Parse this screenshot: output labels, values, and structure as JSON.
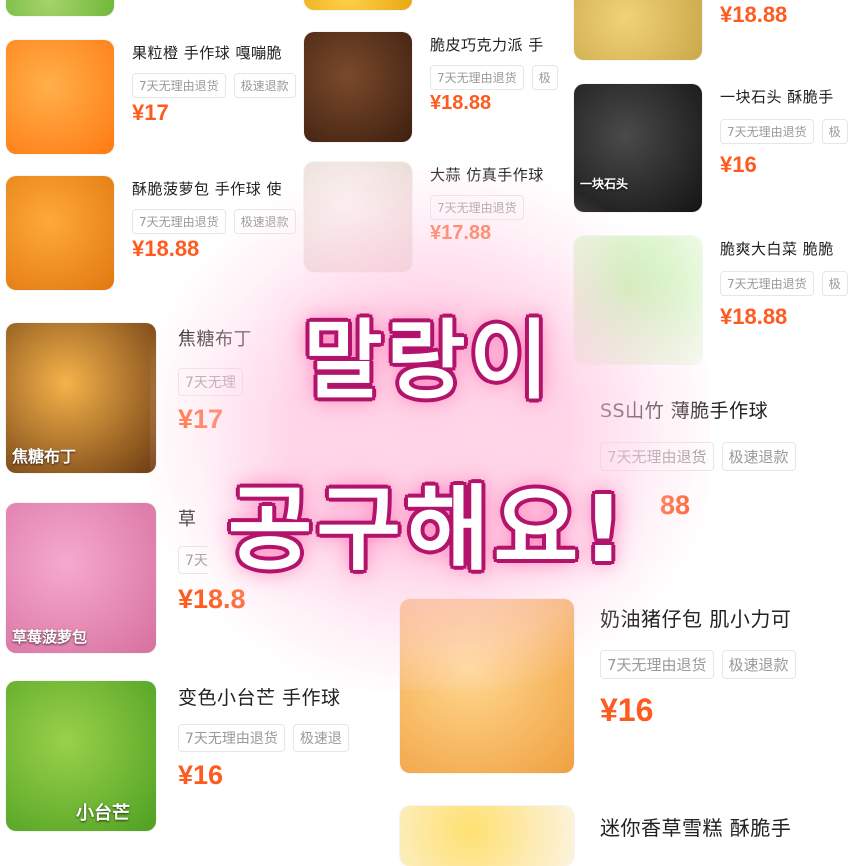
{
  "colors": {
    "price": "#ff5a1f",
    "overlay_stroke": "#b2136b",
    "glow": "#ffc8e1"
  },
  "overlay": {
    "line1": "말랑이",
    "line2": "공구해요!"
  },
  "products": [
    {
      "id": "p0",
      "title": "",
      "tags": [],
      "price": "",
      "thumb_caption": "",
      "thumb_colors": [
        "#a6d36b",
        "#6fb83a"
      ]
    },
    {
      "id": "p1",
      "title": "果粒橙 手作球 嘎嘣脆",
      "tags": [
        "7天无理由退货",
        "极速退款"
      ],
      "price": "¥17",
      "thumb_caption": "",
      "thumb_colors": [
        "#ffb04a",
        "#ff7a12"
      ]
    },
    {
      "id": "p2",
      "title": "酥脆菠萝包 手作球 使",
      "tags": [
        "7天无理由退货",
        "极速退款"
      ],
      "price": "¥18.88",
      "thumb_caption": "",
      "thumb_colors": [
        "#ffa93a",
        "#e07810"
      ]
    },
    {
      "id": "p3",
      "title": "焦糖布丁",
      "tags": [
        "7天无理"
      ],
      "price": "¥17",
      "thumb_caption": "焦糖布丁",
      "thumb_colors": [
        "#f5b34a",
        "#6b3a12"
      ]
    },
    {
      "id": "p4",
      "title": "草",
      "tags": [
        "7天"
      ],
      "price": "¥18.8",
      "thumb_caption": "草莓菠萝包",
      "thumb_colors": [
        "#f6a9cf",
        "#d6709f"
      ]
    },
    {
      "id": "p5",
      "title": "变色小台芒 手作球",
      "tags": [
        "7天无理由退货",
        "极速退"
      ],
      "price": "¥16",
      "thumb_caption": "小台芒",
      "thumb_colors": [
        "#9ad14a",
        "#4ea022"
      ]
    },
    {
      "id": "p6",
      "title": "",
      "tags": [],
      "price": "",
      "thumb_caption": "",
      "thumb_colors": [
        "#ffd04a",
        "#e8a812"
      ]
    },
    {
      "id": "p7",
      "title": "脆皮巧克力派 手",
      "tags": [
        "7天无理由退货",
        "极"
      ],
      "price": "¥18.88",
      "thumb_caption": "",
      "thumb_colors": [
        "#7a4a2a",
        "#3e1f10"
      ]
    },
    {
      "id": "p8",
      "title": "大蒜 仿真手作球",
      "tags": [
        "7天无理由退货"
      ],
      "price": "¥17.88",
      "thumb_caption": "",
      "thumb_colors": [
        "#fbf3f0",
        "#e8d8d2"
      ]
    },
    {
      "id": "p9",
      "title": "",
      "tags": [],
      "price": "¥18.88",
      "thumb_caption": "",
      "thumb_colors": [
        "#f2d278",
        "#c9a84a"
      ]
    },
    {
      "id": "p10",
      "title": "一块石头 酥脆手",
      "tags": [
        "7天无理由退货",
        "极"
      ],
      "price": "¥16",
      "thumb_caption": "一块石头",
      "thumb_colors": [
        "#4a4a4a",
        "#141414"
      ]
    },
    {
      "id": "p11",
      "title": "脆爽大白菜 脆脆",
      "tags": [
        "7天无理由退货",
        "极"
      ],
      "price": "¥18.88",
      "thumb_caption": "",
      "thumb_colors": [
        "#c8f0b0",
        "#f5fbf0"
      ]
    },
    {
      "id": "p12",
      "title": "SS山竹 薄脆手作球",
      "tags": [
        "7天无理由退货",
        "极速退款"
      ],
      "price": "88",
      "thumb_caption": "",
      "thumb_colors": []
    },
    {
      "id": "p13",
      "title": "奶油猪仔包 肌小力可",
      "tags": [
        "7天无理由退货",
        "极速退款"
      ],
      "price": "¥16",
      "thumb_caption": "",
      "thumb_colors": [
        "#ffd890",
        "#f0a040"
      ]
    },
    {
      "id": "p14",
      "title": "迷你香草雪糕 酥脆手",
      "tags": [],
      "price": "",
      "thumb_caption": "",
      "thumb_colors": [
        "#ffe070",
        "#fbf3e0"
      ]
    }
  ]
}
